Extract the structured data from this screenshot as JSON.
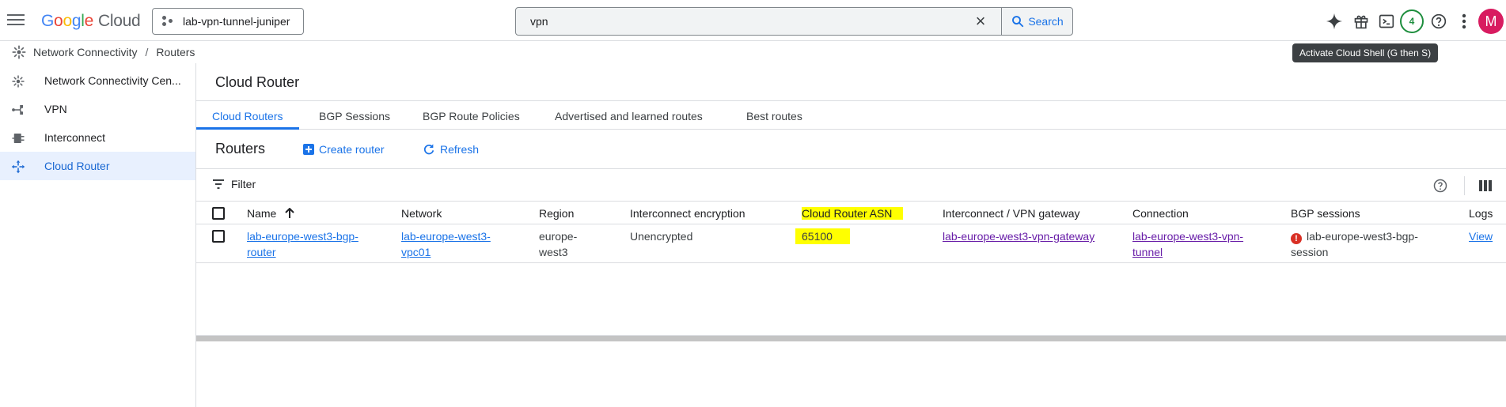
{
  "topbar": {
    "logo_google": "Google",
    "logo_cloud": "Cloud",
    "project": "lab-vpn-tunnel-juniper",
    "search_value": "vpn",
    "search_button": "Search",
    "notifications_count": "4",
    "avatar_initial": "M",
    "icons": [
      "menu-icon",
      "project-icon",
      "search-icon",
      "clear-icon",
      "gemini-icon",
      "gift-icon",
      "cloud-shell-icon",
      "help-icon",
      "more-vert-icon"
    ]
  },
  "tooltip": "Activate Cloud Shell (G then S)",
  "breadcrumb": {
    "section": "Network Connectivity",
    "separator": "/",
    "current": "Routers"
  },
  "sidebar": {
    "items": [
      {
        "label": "Network Connectivity Cen...",
        "icon": "hub-icon"
      },
      {
        "label": "VPN",
        "icon": "vpn-icon"
      },
      {
        "label": "Interconnect",
        "icon": "interconnect-icon"
      },
      {
        "label": "Cloud Router",
        "icon": "router-icon",
        "active": true
      }
    ]
  },
  "main": {
    "title": "Cloud Router",
    "tabs": [
      {
        "label": "Cloud Routers",
        "active": true
      },
      {
        "label": "BGP Sessions"
      },
      {
        "label": "BGP Route Policies"
      },
      {
        "label": "Advertised and learned routes"
      },
      {
        "label": "Best routes"
      }
    ],
    "section_title": "Routers",
    "create_button": "Create router",
    "refresh_button": "Refresh",
    "filter_label": "Filter"
  },
  "table": {
    "columns": [
      "Name",
      "Network",
      "Region",
      "Interconnect encryption",
      "Cloud Router ASN",
      "Interconnect / VPN gateway",
      "Connection",
      "BGP sessions",
      "Logs"
    ],
    "sort_indicator": "ascending",
    "rows": [
      {
        "name_line1": "lab-europe-west3-bgp-",
        "name_line2": "router",
        "network_line1": "lab-europe-west3-",
        "network_line2": "vpc01",
        "region_line1": "europe-",
        "region_line2": "west3",
        "encryption": "Unencrypted",
        "asn": "65100",
        "gateway": "lab-europe-west3-vpn-gateway",
        "connection_line1": "lab-europe-west3-vpn-",
        "connection_line2": "tunnel",
        "bgp_line1": "lab-europe-west3-bgp-",
        "bgp_line2": "session",
        "bgp_status": "error",
        "logs": "View"
      }
    ]
  },
  "colors": {
    "accent": "#1a73e8",
    "visited_link": "#681da8",
    "highlight": "#ffff00",
    "error": "#d93025",
    "avatar": "#d81b60",
    "notification": "#1e8e3e"
  }
}
